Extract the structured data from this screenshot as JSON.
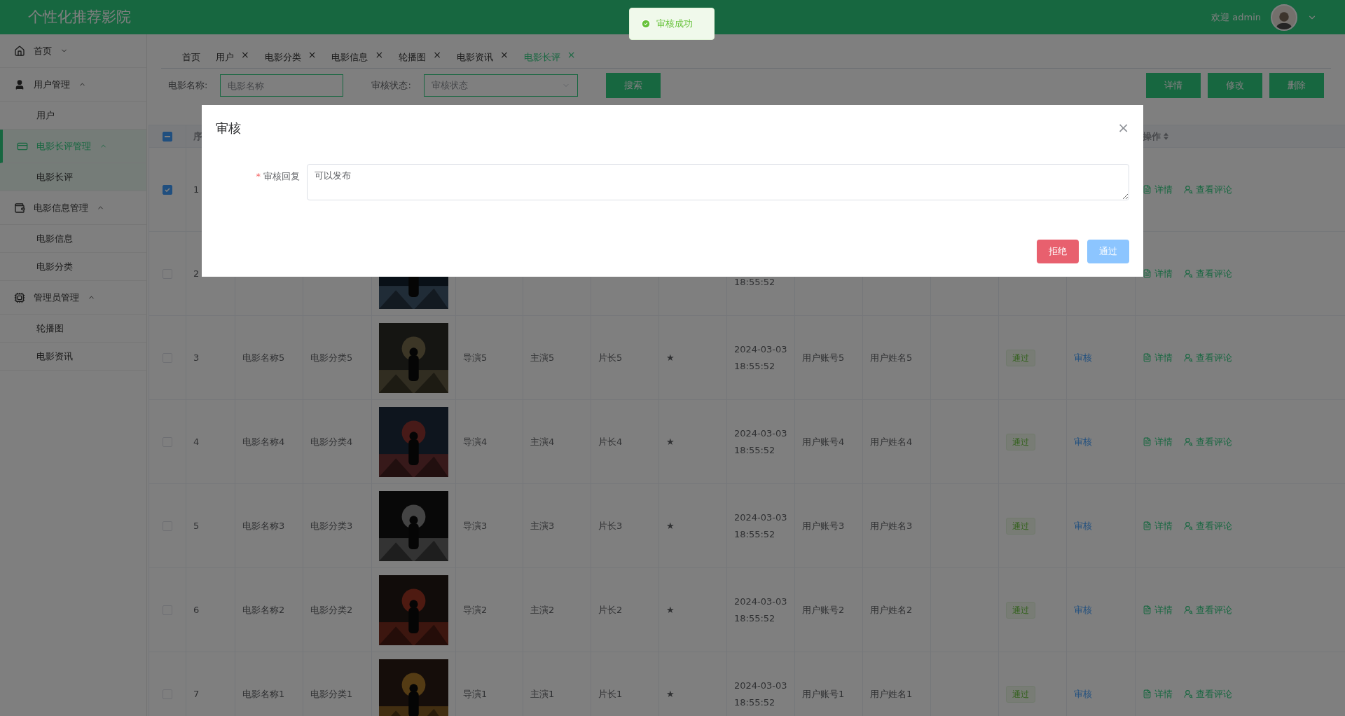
{
  "header": {
    "title": "个性化推荐影院",
    "welcome": "欢迎 admin"
  },
  "toast": {
    "text": "审核成功"
  },
  "sidebar": {
    "items": [
      {
        "label": "首页",
        "expanded": false,
        "selected": false
      },
      {
        "label": "用户管理",
        "expanded": true,
        "selected": false,
        "children": [
          {
            "label": "用户",
            "selected": false
          }
        ]
      },
      {
        "label": "电影长评管理",
        "expanded": true,
        "selected": true,
        "children": [
          {
            "label": "电影长评",
            "selected": true
          }
        ]
      },
      {
        "label": "电影信息管理",
        "expanded": true,
        "selected": false,
        "children": [
          {
            "label": "电影信息",
            "selected": false
          },
          {
            "label": "电影分类",
            "selected": false
          }
        ]
      },
      {
        "label": "管理员管理",
        "expanded": true,
        "selected": false,
        "children": [
          {
            "label": "轮播图",
            "selected": false
          },
          {
            "label": "电影资讯",
            "selected": false
          }
        ]
      }
    ]
  },
  "tabs": [
    {
      "label": "首页",
      "closable": false,
      "selected": false
    },
    {
      "label": "用户",
      "closable": true,
      "selected": false
    },
    {
      "label": "电影分类",
      "closable": true,
      "selected": false
    },
    {
      "label": "电影信息",
      "closable": true,
      "selected": false
    },
    {
      "label": "轮播图",
      "closable": true,
      "selected": false
    },
    {
      "label": "电影资讯",
      "closable": true,
      "selected": false
    },
    {
      "label": "电影长评",
      "closable": true,
      "selected": true
    }
  ],
  "close_glyph": "×",
  "search": {
    "fields": [
      {
        "kind": "input",
        "label": "电影名称:",
        "placeholder": "电影名称"
      },
      {
        "kind": "select",
        "label": "审核状态:",
        "placeholder": "审核状态"
      }
    ],
    "button": "搜索"
  },
  "toolbar": [
    "详情",
    "修改",
    "删除"
  ],
  "table": {
    "select_all_indeterminate": true,
    "columns": [
      "序",
      "操作"
    ],
    "rows": [
      {
        "checked": true,
        "index": "1",
        "actions": [
          "详情",
          "查看评论"
        ]
      },
      {
        "checked": false,
        "index": "2",
        "poster": {
          "kind": "picture"
        },
        "time": "18:55:52",
        "actions": [
          "详情",
          "查看评论"
        ]
      },
      {
        "checked": false,
        "index": "3",
        "name": "电影名称5",
        "category": "电影分类5",
        "poster": {
          "kind": "picture"
        },
        "director": "导演5",
        "actor": "主演5",
        "length": "片长5",
        "rating": "★",
        "date": "2024-03-03",
        "time": "18:55:52",
        "account": "用户账号5",
        "username": "用户姓名5",
        "status": "通过",
        "audit": "审核",
        "actions": [
          "详情",
          "查看评论"
        ]
      },
      {
        "checked": false,
        "index": "4",
        "name": "电影名称4",
        "category": "电影分类4",
        "poster": {
          "kind": "picture"
        },
        "director": "导演4",
        "actor": "主演4",
        "length": "片长4",
        "rating": "★",
        "date": "2024-03-03",
        "time": "18:55:52",
        "account": "用户账号4",
        "username": "用户姓名4",
        "status": "通过",
        "audit": "审核",
        "actions": [
          "详情",
          "查看评论"
        ]
      },
      {
        "checked": false,
        "index": "5",
        "name": "电影名称3",
        "category": "电影分类3",
        "poster": {
          "kind": "picture"
        },
        "director": "导演3",
        "actor": "主演3",
        "length": "片长3",
        "rating": "★",
        "date": "2024-03-03",
        "time": "18:55:52",
        "account": "用户账号3",
        "username": "用户姓名3",
        "status": "通过",
        "audit": "审核",
        "actions": [
          "详情",
          "查看评论"
        ]
      },
      {
        "checked": false,
        "index": "6",
        "name": "电影名称2",
        "category": "电影分类2",
        "poster": {
          "kind": "picture"
        },
        "director": "导演2",
        "actor": "主演2",
        "length": "片长2",
        "rating": "★",
        "date": "2024-03-03",
        "time": "18:55:52",
        "account": "用户账号2",
        "username": "用户姓名2",
        "status": "通过",
        "audit": "审核",
        "actions": [
          "详情",
          "查看评论"
        ]
      },
      {
        "checked": false,
        "index": "7",
        "name": "电影名称1",
        "category": "电影分类1",
        "poster": {
          "kind": "picture"
        },
        "director": "导演1",
        "actor": "主演1",
        "length": "片长1",
        "rating": "★",
        "date": "2024-03-03",
        "time": "18:55:52",
        "account": "用户账号1",
        "username": "用户姓名1",
        "status": "通过",
        "audit": "审核",
        "actions": [
          "详情",
          "查看评论"
        ]
      }
    ]
  },
  "dialog": {
    "title": "审核",
    "close_glyph": "×",
    "field": {
      "required_mark": "*",
      "label": "审核回复",
      "value": "可以发布"
    },
    "buttons": [
      {
        "kind": "danger",
        "label": "拒绝"
      },
      {
        "kind": "primary",
        "label": "通过"
      }
    ]
  }
}
